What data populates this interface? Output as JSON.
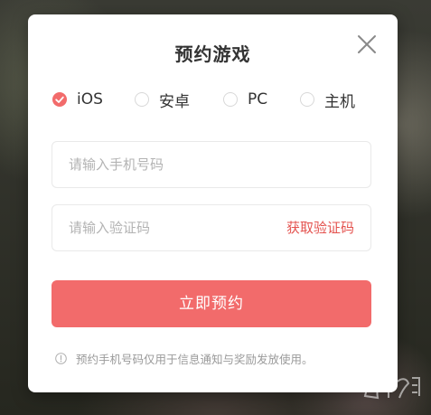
{
  "modal": {
    "title": "预约游戏",
    "close_icon": "close-icon"
  },
  "platforms": [
    {
      "label": "iOS",
      "selected": true
    },
    {
      "label": "安卓",
      "selected": false
    },
    {
      "label": "PC",
      "selected": false
    },
    {
      "label": "主机",
      "selected": false
    }
  ],
  "form": {
    "phone_placeholder": "请输入手机号码",
    "phone_value": "",
    "code_placeholder": "请输入验证码",
    "code_value": "",
    "get_code_label": "获取验证码",
    "submit_label": "立即预约"
  },
  "notice": {
    "icon": "info-icon",
    "text": "预约手机号码仅用于信息通知与奖励发放使用。"
  },
  "watermark": {
    "icon": "site-logo-watermark"
  },
  "colors": {
    "accent": "#f26b6b",
    "link": "#e4534f",
    "title": "#333333",
    "muted": "#9a9a9a",
    "border": "#e9e9e9"
  }
}
